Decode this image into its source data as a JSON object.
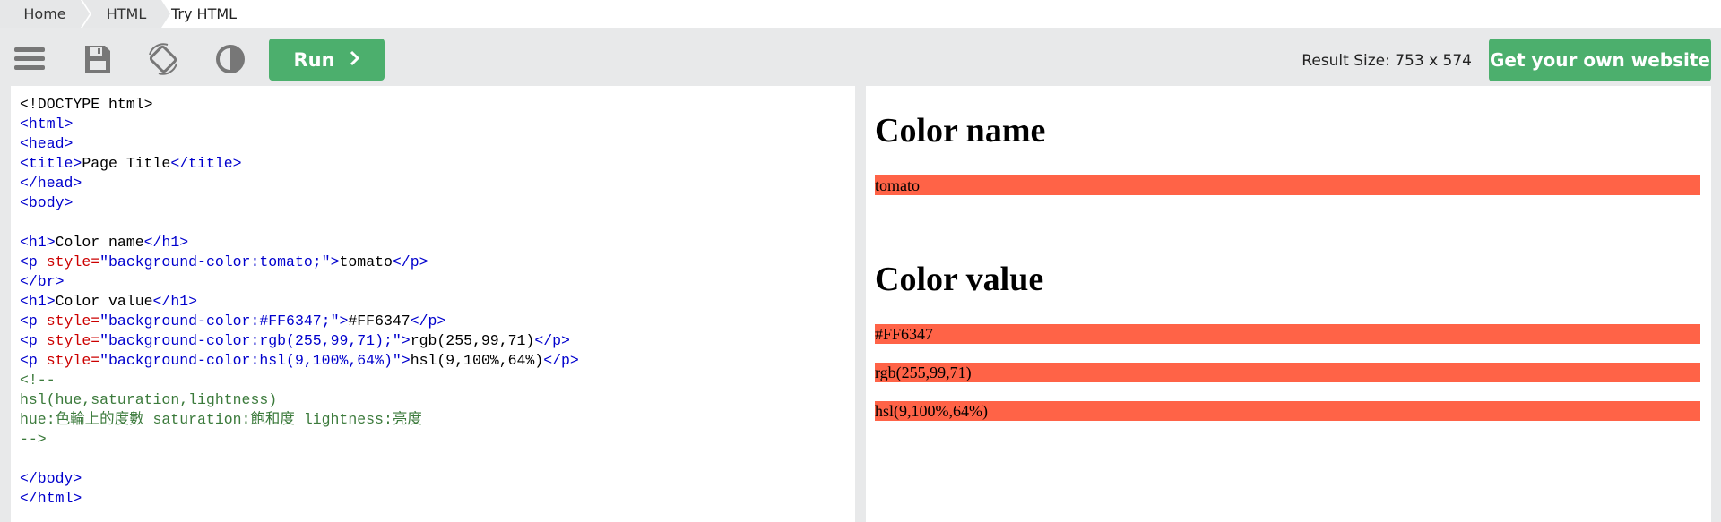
{
  "breadcrumb": {
    "home": "Home",
    "html": "HTML",
    "current": "Try HTML"
  },
  "toolbar": {
    "icons": [
      "menu-icon",
      "save-icon",
      "rotate-icon",
      "contrast-icon"
    ],
    "run_label": "Run",
    "result_size": "Result Size: 753 x 574",
    "get_website_label": "Get your own website"
  },
  "editor": {
    "lines": {
      "l1": "<!DOCTYPE html>",
      "l2": "<html>",
      "l3": "<head>",
      "l4a": "<title>",
      "l4b": "Page Title",
      "l4c": "</title>",
      "l5": "</head>",
      "l6": "<body>",
      "l7": "",
      "l8a": "<h1>",
      "l8b": "Color name",
      "l8c": "</h1>",
      "l9a": "<p",
      "l9b": " style=",
      "l9c": "\"background-color:tomato;\"",
      "l9d": ">",
      "l9e": "tomato",
      "l9f": "</p>",
      "l10": "</br>",
      "l11a": "<h1>",
      "l11b": "Color value",
      "l11c": "</h1>",
      "l12a": "<p",
      "l12b": " style=",
      "l12c": "\"background-color:#FF6347;\"",
      "l12d": ">",
      "l12e": "#FF6347",
      "l12f": "</p>",
      "l13a": "<p",
      "l13b": " style=",
      "l13c": "\"background-color:rgb(255,99,71);\"",
      "l13d": ">",
      "l13e": "rgb(255,99,71)",
      "l13f": "</p>",
      "l14a": "<p",
      "l14b": " style=",
      "l14c": "\"background-color:hsl(9,100%,64%)\"",
      "l14d": ">",
      "l14e": "hsl(9,100%,64%)",
      "l14f": "</p>",
      "l15": "<!--",
      "l16": "hsl(hue,saturation,lightness)",
      "l17": "hue:色輪上的度數 saturation:飽和度 lightness:亮度",
      "l18": "-->",
      "l19": "",
      "l20": "</body>",
      "l21": "</html>"
    }
  },
  "result": {
    "h1_name": "Color name",
    "p_tomato": "tomato",
    "h1_value": "Color value",
    "p_hex": "#FF6347",
    "p_rgb": "rgb(255,99,71)",
    "p_hsl": "hsl(9,100%,64%)"
  },
  "colors": {
    "accent": "#4caf6d",
    "tomato": "#ff6347"
  }
}
